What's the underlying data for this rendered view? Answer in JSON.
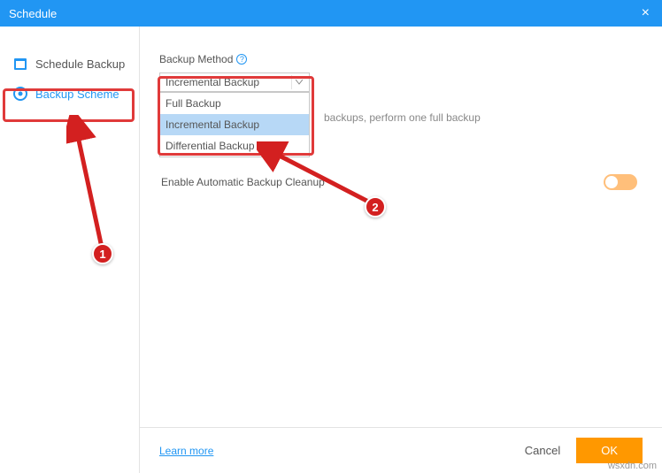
{
  "header": {
    "title": "Schedule"
  },
  "sidebar": {
    "items": [
      {
        "label": "Schedule Backup"
      },
      {
        "label": "Backup Scheme"
      }
    ]
  },
  "main": {
    "backup_method_label": "Backup Method",
    "selected": "Incremental Backup",
    "options": [
      "Full Backup",
      "Incremental Backup",
      "Differential Backup"
    ],
    "helper_text": "backups, perform one full backup",
    "cleanup_label": "Enable Automatic Backup Cleanup"
  },
  "footer": {
    "learn": "Learn more",
    "cancel": "Cancel",
    "ok": "OK"
  },
  "annotations": {
    "badge1": "1",
    "badge2": "2"
  },
  "watermark": "wsxdn.com"
}
